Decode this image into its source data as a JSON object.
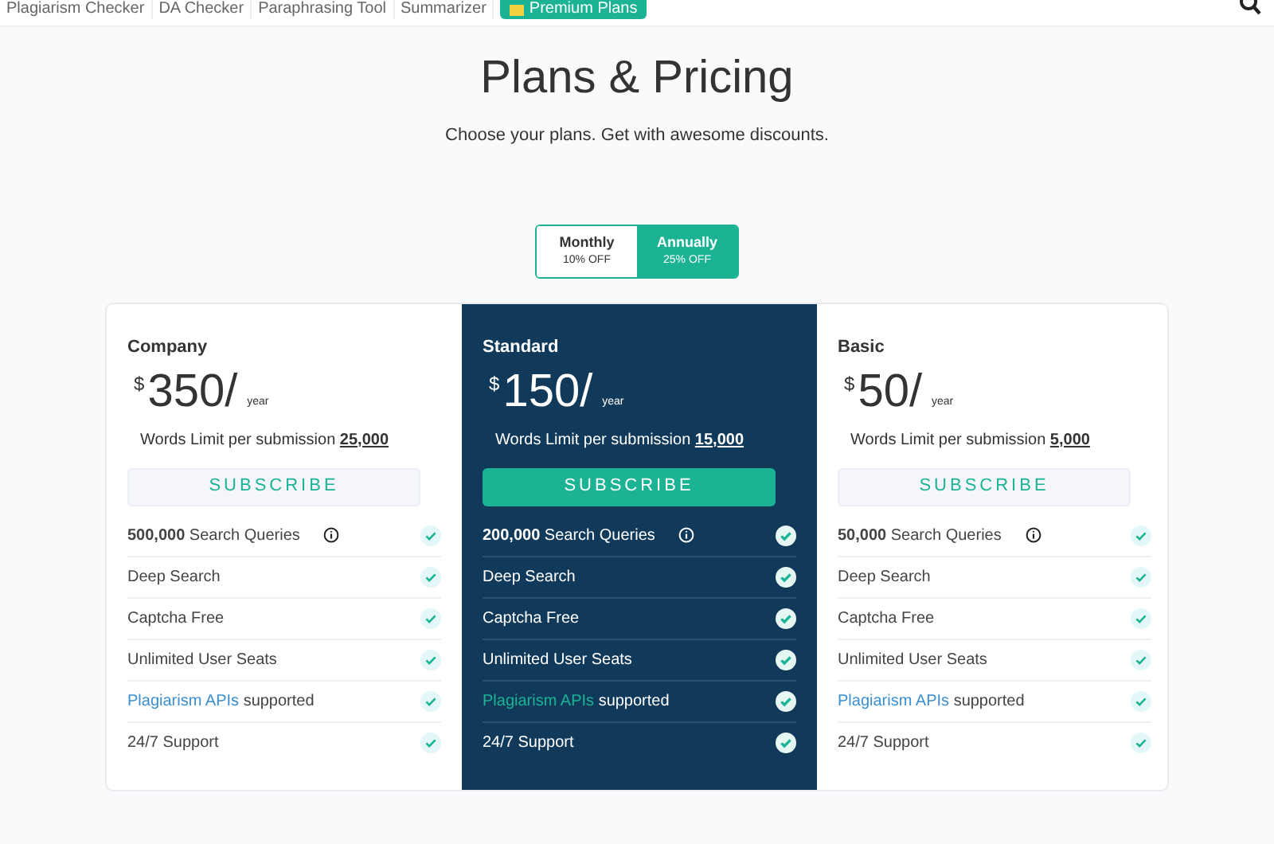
{
  "nav": {
    "items": [
      {
        "label": "Plagiarism Checker",
        "selected": false
      },
      {
        "label": "DA Checker",
        "selected": false
      },
      {
        "label": "Paraphrasing Tool",
        "selected": false
      },
      {
        "label": "Summarizer",
        "selected": false
      },
      {
        "label": "Premium Plans",
        "selected": true
      }
    ]
  },
  "title": "Plans & Pricing",
  "subtitle": "Choose your plans. Get with awesome discounts.",
  "billing": [
    {
      "label": "Monthly",
      "discount": "10% OFF",
      "selected": false
    },
    {
      "label": "Annually",
      "discount": "25% OFF",
      "selected": true
    }
  ],
  "plans": [
    {
      "name": "Company",
      "featured": false,
      "currency": "$",
      "price": "350/",
      "period": "year",
      "limit_label": "Words Limit per submission",
      "limit": "25,000",
      "button": "SUBSCRIBE",
      "features": [
        {
          "text": "**500,000** Search Queries",
          "info": true
        },
        {
          "text": "Deep Search"
        },
        {
          "text": "Captcha Free"
        },
        {
          "text": "Unlimited User Seats"
        },
        {
          "link": "Plagiarism APIs",
          "text": "supported"
        },
        {
          "text": "24/7 Support"
        }
      ]
    },
    {
      "name": "Standard",
      "featured": true,
      "currency": "$",
      "price": "150/",
      "period": "year",
      "limit_label": "Words Limit per submission",
      "limit": "15,000",
      "button": "SUBSCRIBE",
      "features": [
        {
          "text": "**200,000** Search Queries",
          "info": true
        },
        {
          "text": "Deep Search"
        },
        {
          "text": "Captcha Free"
        },
        {
          "text": "Unlimited User Seats"
        },
        {
          "link": "Plagiarism APIs",
          "text": "supported"
        },
        {
          "text": "24/7 Support"
        }
      ]
    },
    {
      "name": "Basic",
      "featured": false,
      "currency": "$",
      "price": "50/",
      "period": "year",
      "limit_label": "Words Limit per submission",
      "limit": "5,000",
      "button": "SUBSCRIBE",
      "features": [
        {
          "text": "**50,000** Search Queries",
          "info": true
        },
        {
          "text": "Deep Search"
        },
        {
          "text": "Captcha Free"
        },
        {
          "text": "Unlimited User Seats"
        },
        {
          "link": "Plagiarism APIs",
          "text": "supported"
        },
        {
          "text": "24/7 Support"
        }
      ]
    }
  ]
}
